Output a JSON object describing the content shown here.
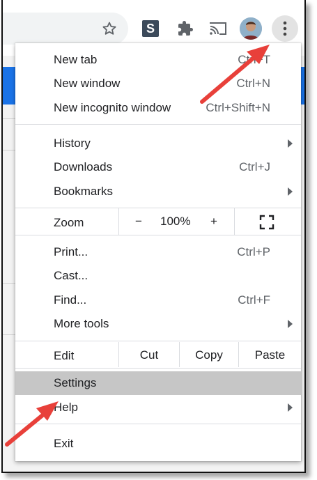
{
  "toolbar": {
    "extension_letter": "S",
    "icons": [
      "star-icon",
      "extension-s-icon",
      "puzzle-icon",
      "cast-icon",
      "avatar",
      "kebab-menu-icon"
    ]
  },
  "menu": {
    "new_tab": {
      "label": "New tab",
      "shortcut": "Ctrl+T"
    },
    "new_window": {
      "label": "New window",
      "shortcut": "Ctrl+N"
    },
    "incognito": {
      "label": "New incognito window",
      "shortcut": "Ctrl+Shift+N"
    },
    "history": {
      "label": "History"
    },
    "downloads": {
      "label": "Downloads",
      "shortcut": "Ctrl+J"
    },
    "bookmarks": {
      "label": "Bookmarks"
    },
    "zoom": {
      "label": "Zoom",
      "minus": "−",
      "value": "100%",
      "plus": "+"
    },
    "print": {
      "label": "Print...",
      "shortcut": "Ctrl+P"
    },
    "cast": {
      "label": "Cast..."
    },
    "find": {
      "label": "Find...",
      "shortcut": "Ctrl+F"
    },
    "more_tools": {
      "label": "More tools"
    },
    "edit": {
      "label": "Edit",
      "cut": "Cut",
      "copy": "Copy",
      "paste": "Paste"
    },
    "settings": {
      "label": "Settings"
    },
    "help": {
      "label": "Help"
    },
    "exit": {
      "label": "Exit"
    }
  },
  "colors": {
    "highlight": "#c6c6c6",
    "annotation_arrow": "#e8403a",
    "brand_band": "#1a73e8"
  }
}
